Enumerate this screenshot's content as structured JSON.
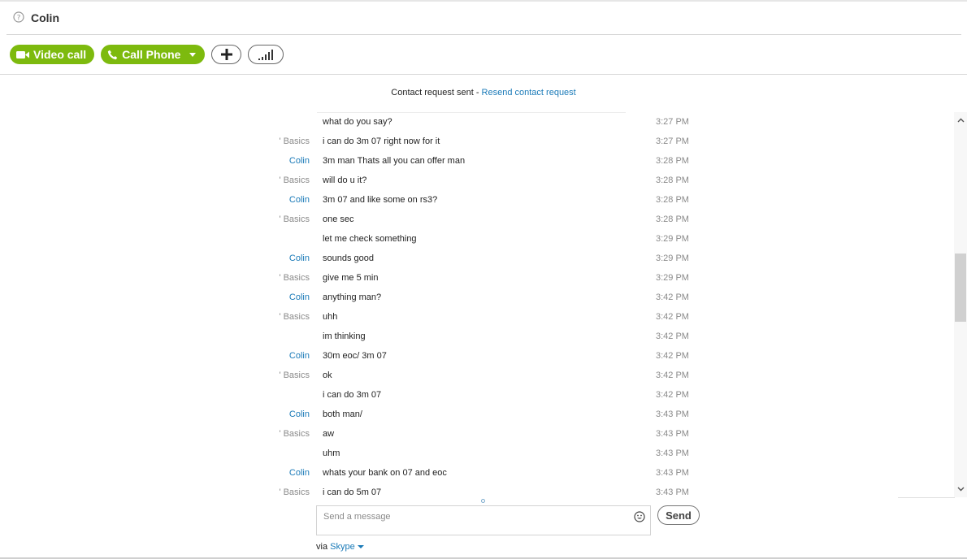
{
  "header": {
    "contact_name": "Colin"
  },
  "actions": {
    "video_call_label": "Video call",
    "call_phone_label": "Call Phone"
  },
  "notice": {
    "text": "Contact request sent - ",
    "link": "Resend contact request"
  },
  "messages": [
    {
      "sender": "",
      "text": "what do you say?",
      "time": "3:27 PM"
    },
    {
      "sender": "' Basics",
      "text": "i can do 3m 07 right now for it",
      "time": "3:27 PM"
    },
    {
      "sender": "Colin",
      "text": "3m man Thats all you can offer man",
      "time": "3:28 PM"
    },
    {
      "sender": "' Basics",
      "text": "will do u it?",
      "time": "3:28 PM"
    },
    {
      "sender": "Colin",
      "text": "3m 07 and like some on rs3?",
      "time": "3:28 PM"
    },
    {
      "sender": "' Basics",
      "text": "one sec",
      "time": "3:28 PM"
    },
    {
      "sender": "",
      "text": "let me check something",
      "time": "3:29 PM"
    },
    {
      "sender": "Colin",
      "text": "sounds good",
      "time": "3:29 PM"
    },
    {
      "sender": "' Basics",
      "text": "give me 5 min",
      "time": "3:29 PM"
    },
    {
      "sender": "Colin",
      "text": "anything man?",
      "time": "3:42 PM"
    },
    {
      "sender": "' Basics",
      "text": "uhh",
      "time": "3:42 PM"
    },
    {
      "sender": "",
      "text": "im thinking",
      "time": "3:42 PM"
    },
    {
      "sender": "Colin",
      "text": "30m eoc/ 3m 07",
      "time": "3:42 PM"
    },
    {
      "sender": "' Basics",
      "text": "ok",
      "time": "3:42 PM"
    },
    {
      "sender": "",
      "text": "i can do 3m 07",
      "time": "3:42 PM"
    },
    {
      "sender": "Colin",
      "text": "both man/",
      "time": "3:43 PM"
    },
    {
      "sender": "' Basics",
      "text": "aw",
      "time": "3:43 PM"
    },
    {
      "sender": "",
      "text": "uhm",
      "time": "3:43 PM"
    },
    {
      "sender": "Colin",
      "text": "whats your bank on 07 and eoc",
      "time": "3:43 PM"
    },
    {
      "sender": "' Basics",
      "text": "i can do 5m 07",
      "time": "3:43 PM"
    }
  ],
  "composer": {
    "placeholder": "Send a message",
    "send_label": "Send",
    "via_label": "via ",
    "via_service": "Skype"
  },
  "colors": {
    "accent_green": "#7dba0e",
    "link_blue": "#1a7ab8",
    "muted_gray": "#8a8a8a"
  }
}
